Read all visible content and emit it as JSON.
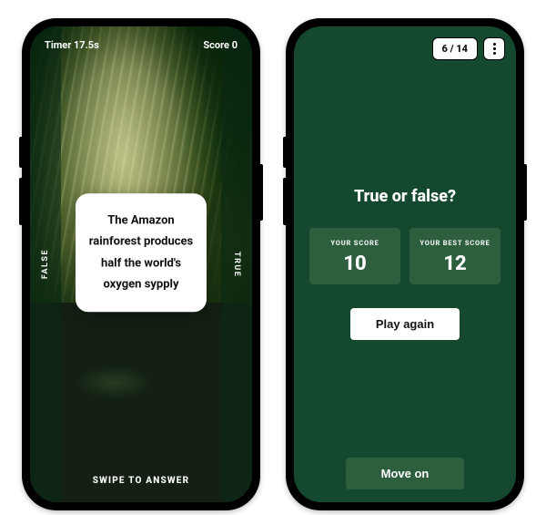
{
  "phoneA": {
    "timer_label": "Timer 17.5s",
    "score_label": "Score 0",
    "side_false": "FALSE",
    "side_true": "TRUE",
    "question": "The Amazon rainforest produces half the world's oxygen sypply",
    "swipe_hint": "SWIPE TO ANSWER"
  },
  "phoneB": {
    "progress": "6 / 14",
    "title": "True or false?",
    "your_score_label": "YOUR SCORE",
    "your_score_value": "10",
    "best_score_label": "YOUR BEST SCORE",
    "best_score_value": "12",
    "play_again": "Play again",
    "move_on": "Move on"
  }
}
